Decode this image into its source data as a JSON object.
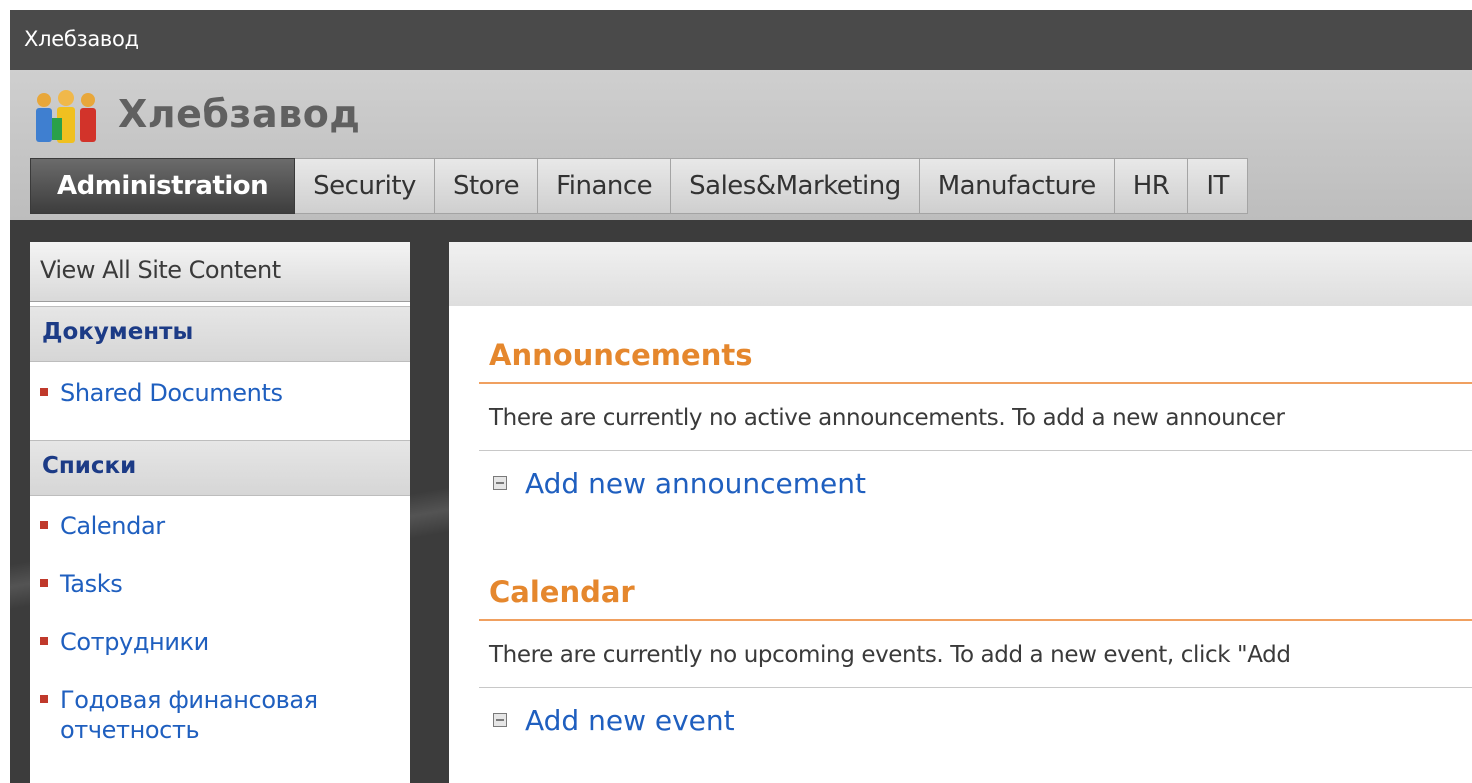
{
  "window": {
    "title": "Хлебзавод"
  },
  "site": {
    "title": "Хлебзавод",
    "logo_icon": "people-logo-icon"
  },
  "tabs": [
    {
      "label": "Administration",
      "active": true
    },
    {
      "label": "Security"
    },
    {
      "label": "Store"
    },
    {
      "label": "Finance"
    },
    {
      "label": "Sales&Marketing"
    },
    {
      "label": "Manufacture"
    },
    {
      "label": "HR"
    },
    {
      "label": "IT"
    }
  ],
  "leftnav": {
    "view_all": "View All Site Content",
    "sections": [
      {
        "heading": "Документы",
        "items": [
          "Shared Documents"
        ]
      },
      {
        "heading": "Списки",
        "items": [
          "Calendar",
          "Tasks",
          "Сотрудники",
          "Годовая финансовая отчетность"
        ]
      }
    ]
  },
  "webparts": {
    "announcements": {
      "title": "Announcements",
      "empty_text": "There are currently no active announcements. To add a new announcer",
      "add_label": "Add new announcement"
    },
    "calendar": {
      "title": "Calendar",
      "empty_text": "There are currently no upcoming events. To add a new event, click \"Add",
      "add_label": "Add new event"
    }
  },
  "colors": {
    "accent_orange": "#e5872d",
    "link_blue": "#1f5fbf",
    "nav_heading": "#1c3b86",
    "bullet_red": "#c0392b"
  }
}
